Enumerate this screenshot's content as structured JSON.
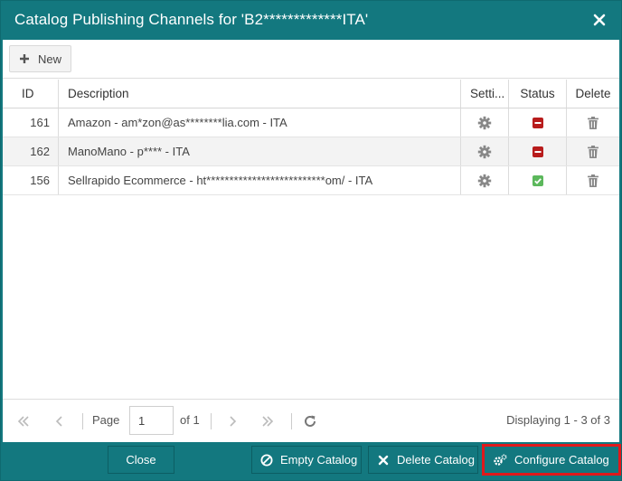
{
  "dialog": {
    "title": "Catalog Publishing Channels for 'B2*************ITA'",
    "close_icon": "close-icon"
  },
  "toolbar": {
    "new_label": "New",
    "new_icon": "plus-icon"
  },
  "grid": {
    "columns": {
      "id": "ID",
      "description": "Description",
      "settings": "Setti...",
      "status": "Status",
      "delete": "Delete"
    },
    "rows": [
      {
        "id": "161",
        "description": "Amazon - am*zon@as********lia.com - ITA",
        "status": "inactive"
      },
      {
        "id": "162",
        "description": "ManoMano - p**** - ITA",
        "status": "inactive"
      },
      {
        "id": "156",
        "description": "Sellrapido Ecommerce - ht**************************om/ - ITA",
        "status": "active"
      }
    ]
  },
  "pager": {
    "page_label": "Page",
    "page_value": "1",
    "of_label": "of 1",
    "display_text": "Displaying 1 - 3 of 3"
  },
  "footer": {
    "close_label": "Close",
    "empty_label": "Empty Catalog",
    "delete_label": "Delete Catalog",
    "configure_label": "Configure Catalog"
  },
  "colors": {
    "accent": "#13787f",
    "status_inactive": "#b81c1c",
    "status_active": "#5cb85c",
    "highlight": "#e0191b"
  }
}
